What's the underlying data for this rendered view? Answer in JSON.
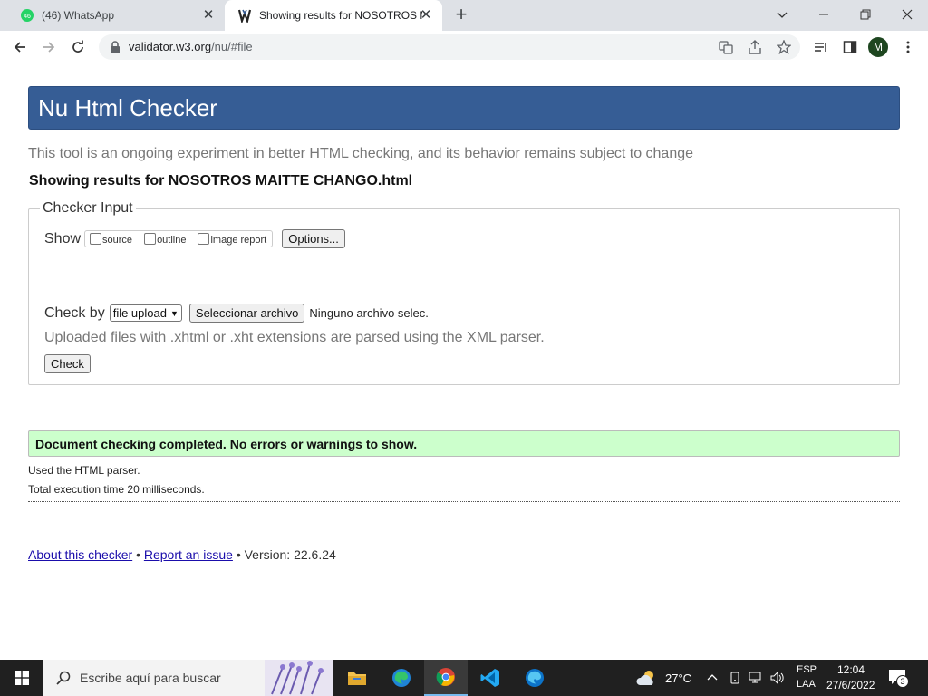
{
  "browser": {
    "tabs": [
      {
        "label": "(46) WhatsApp",
        "badge": "46"
      },
      {
        "label": "Showing results for NOSOTROS MAITTE CHANGO.html"
      }
    ],
    "url_host": "validator.w3.org",
    "url_path": "/nu/#file",
    "profile_initial": "M"
  },
  "page": {
    "title": "Nu Html Checker",
    "subtitle": "This tool is an ongoing experiment in better HTML checking, and its behavior remains subject to change",
    "showing": "Showing results for NOSOTROS MAITTE CHANGO.html",
    "checker_input": {
      "legend": "Checker Input",
      "show_label": "Show",
      "checkboxes": [
        "source",
        "outline",
        "image report"
      ],
      "options_button": "Options...",
      "check_by_label": "Check by",
      "check_by_value": "file upload",
      "file_button": "Seleccionar archivo",
      "file_status": "Ninguno archivo selec.",
      "xml_note": "Uploaded files with .xhtml or .xht extensions are parsed using the XML parser.",
      "check_button": "Check"
    },
    "result": "Document checking completed. No errors or warnings to show.",
    "parser_note": "Used the HTML parser.",
    "execution_time": "Total execution time 20 milliseconds.",
    "footer": {
      "about": "About this checker",
      "sep1": "•",
      "report": "Report an issue",
      "sep2": "•",
      "version": "Version: 22.6.24"
    }
  },
  "taskbar": {
    "search_placeholder": "Escribe aquí para buscar",
    "temperature": "27°C",
    "lang_top": "ESP",
    "lang_bottom": "LAA",
    "time": "12:04",
    "date": "27/6/2022",
    "notifications": "3"
  },
  "colors": {
    "banner": "#365d95",
    "success_bg": "#ccffcc",
    "taskbar": "#202020"
  }
}
